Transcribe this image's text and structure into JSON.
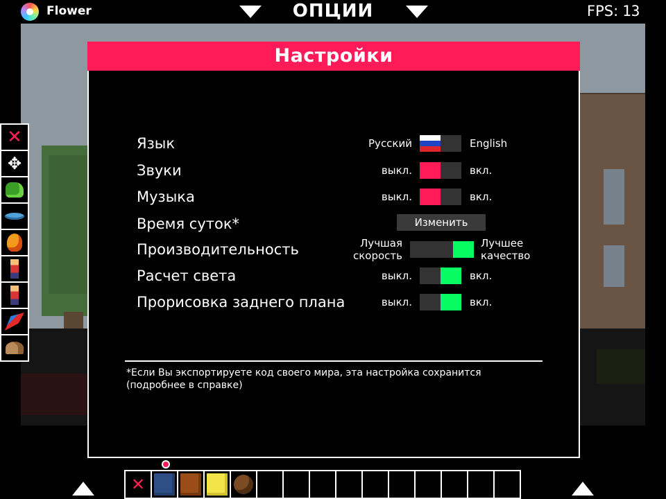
{
  "app": {
    "name": "Flower",
    "logo_icon": "flower-logo-icon"
  },
  "header": {
    "title": "ОПЦИИ",
    "prev_icon": "triangle-down-icon",
    "next_icon": "triangle-down-icon"
  },
  "fps": {
    "label": "FPS:",
    "value": "13"
  },
  "dialog": {
    "title": "Настройки",
    "settings": [
      {
        "label": "Язык",
        "left": "Русский",
        "right": "English",
        "state": "left",
        "knob": "russian-flag"
      },
      {
        "label": "Звуки",
        "left": "выкл.",
        "right": "вкл.",
        "state": "off"
      },
      {
        "label": "Музыка",
        "left": "выкл.",
        "right": "вкл.",
        "state": "off"
      },
      {
        "label": "Время суток*",
        "button": "Изменить"
      },
      {
        "label": "Производительность",
        "left": "Лучшая скорость",
        "right": "Лучшее качество",
        "state": "right"
      },
      {
        "label": "Расчет света",
        "left": "выкл.",
        "right": "вкл.",
        "state": "on"
      },
      {
        "label": "Прорисовка заднего плана",
        "left": "выкл.",
        "right": "вкл.",
        "state": "on"
      }
    ],
    "footnote_line1": "*Если Вы экспортируете код своего мира, эта настройка сохранится",
    "footnote_line2": "(подробнее в справке)"
  },
  "left_toolbar": [
    "close-icon",
    "move-arrows-icon",
    "frog-icon",
    "fish-icon",
    "fire-icon",
    "person-icon",
    "person-icon",
    "parrot-icon",
    "snail-icon"
  ],
  "hotbar": [
    "close-icon",
    "water-block",
    "dirt-block",
    "sand-block",
    "seed-item",
    "",
    "",
    "",
    "",
    "",
    "",
    "",
    "",
    "",
    ""
  ],
  "colors": {
    "accent": "#ff1a58",
    "on": "#06fc62",
    "toggle_track": "#333333",
    "button_bg": "#3a3a3a"
  }
}
